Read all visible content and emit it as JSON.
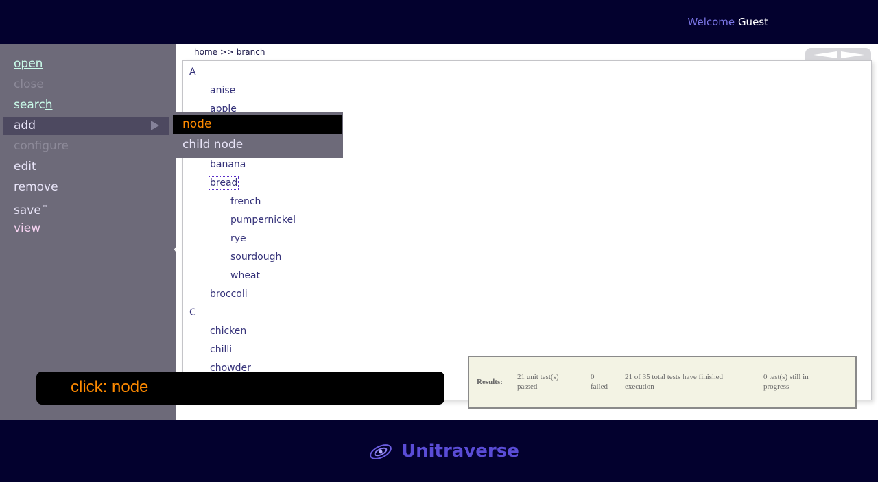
{
  "header": {
    "welcome_label": "Welcome",
    "user": "Guest"
  },
  "sidebar": {
    "items": [
      {
        "label": "open"
      },
      {
        "label": "close"
      },
      {
        "label": "searc",
        "suffix": "h"
      },
      {
        "label": "add"
      },
      {
        "label": "configure"
      },
      {
        "label": "edit"
      },
      {
        "label": "remove"
      },
      {
        "label_s": "s",
        "label_rest": "ave",
        "star": "*"
      },
      {
        "label": "view"
      }
    ],
    "collapse_glyph": "〈"
  },
  "submenu": {
    "items": [
      "node",
      "child node"
    ]
  },
  "breadcrumb": "home  >>  branch",
  "tree": {
    "items": [
      "A",
      "anise",
      "apple",
      "banana",
      "bread",
      "french",
      "pumpernickel",
      "rye",
      "sourdough",
      "wheat",
      "broccoli",
      "C",
      "chicken",
      "chilli",
      "chowder"
    ]
  },
  "results": {
    "label": "Results:",
    "passed_count": "21 unit test(s)",
    "passed_label": "passed",
    "failed_count": "0",
    "failed_label": "failed",
    "total_line1": "21 of 35 total tests have finished",
    "total_line2": "execution",
    "progress_line1": "0 test(s) still in",
    "progress_line2": "progress"
  },
  "overlay": {
    "text": "click: node"
  },
  "footer": {
    "brand": "Unitraverse"
  },
  "colors": {
    "header_bg": "#03012e",
    "sidebar_bg": "#6d6a79",
    "accent_orange": "#ff8a00",
    "tree_text": "#36337a",
    "brand": "#5a4cd6"
  },
  "icons": {
    "collapse": "collapse-sidebar-icon",
    "nav_back": "nav-back-icon",
    "nav_forward": "nav-forward-icon",
    "logo": "galaxy-logo-icon",
    "submenu_arrow": "submenu-arrow-icon"
  }
}
